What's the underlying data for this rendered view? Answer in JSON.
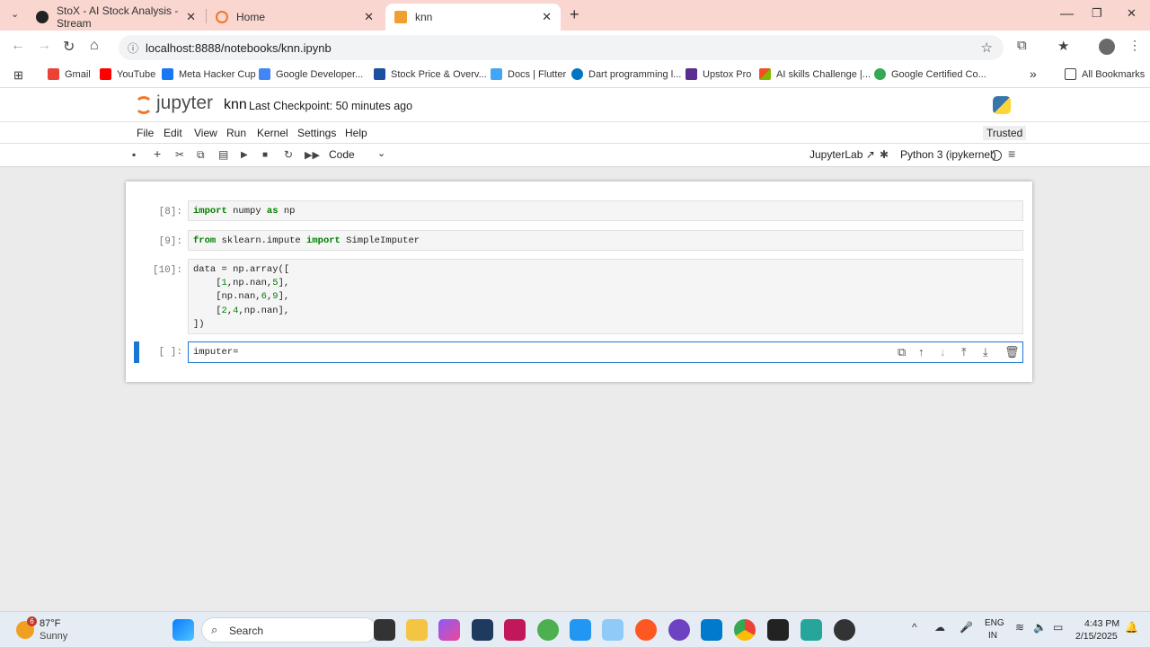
{
  "browser": {
    "tabs": [
      {
        "title": "StoX - AI Stock Analysis - Stream",
        "favicon_color": "#222222"
      },
      {
        "title": "Home",
        "favicon_color": "#f37626"
      },
      {
        "title": "knn",
        "favicon_color": "#f37626"
      }
    ],
    "new_tab": "+",
    "window_controls": {
      "minimize": "—",
      "maximize": "❐",
      "close": "✕"
    },
    "url": "localhost:8888/notebooks/knn.ipynb",
    "bookmarks": [
      {
        "label": "Gmail",
        "color": "#ea4335"
      },
      {
        "label": "YouTube",
        "color": "#ff0000"
      },
      {
        "label": "Meta Hacker Cup",
        "color": "#1877f2"
      },
      {
        "label": "Google Developer...",
        "color": "#4285f4"
      },
      {
        "label": "Stock Price & Overv...",
        "color": "#1b4fa0"
      },
      {
        "label": "Docs | Flutter",
        "color": "#42a5f5"
      },
      {
        "label": "Dart programming l...",
        "color": "#0175c2"
      },
      {
        "label": "Upstox Pro",
        "color": "#5a2d91"
      },
      {
        "label": "AI skills Challenge |...",
        "color": "#f25022"
      },
      {
        "label": "Google Certified Co...",
        "color": "#34a853"
      }
    ],
    "more_bookmarks": "»",
    "all_bookmarks": "All Bookmarks"
  },
  "jupyter": {
    "logo_text": "jupyter",
    "notebook_name": "knn",
    "checkpoint": "Last Checkpoint: 50 minutes ago",
    "trusted": "Trusted",
    "menu": [
      "File",
      "Edit",
      "View",
      "Run",
      "Kernel",
      "Settings",
      "Help"
    ],
    "cell_type": "Code",
    "jupyterlab_link": "JupyterLab",
    "kernel": "Python 3 (ipykernel)",
    "accent": "#f37626"
  },
  "cells": [
    {
      "prompt": "[8]:",
      "lines": [
        [
          "kw:import",
          " numpy ",
          "kw:as",
          " np"
        ]
      ]
    },
    {
      "prompt": "[9]:",
      "lines": [
        [
          "kw:from",
          " sklearn.impute ",
          "kw:import",
          " SimpleImputer"
        ]
      ]
    },
    {
      "prompt": "[10]:",
      "lines": [
        [
          "data = np.array(["
        ],
        [
          "    [",
          "num:1",
          ",np.nan,",
          "num:5",
          "],"
        ],
        [
          "    [np.nan,",
          "num:6",
          ",",
          "num:9",
          "],"
        ],
        [
          "    [",
          "num:2",
          ",",
          "num:4",
          ",np.nan],"
        ],
        [
          "])"
        ]
      ]
    },
    {
      "prompt": "[ ]:",
      "lines": [
        [
          "imputer="
        ]
      ]
    }
  ],
  "taskbar": {
    "weather_temp": "87°F",
    "weather_desc": "Sunny",
    "weather_badge": "6",
    "search": "Search",
    "lang_top": "ENG",
    "lang_bottom": "IN",
    "time": "4:43 PM",
    "date": "2/15/2025"
  }
}
